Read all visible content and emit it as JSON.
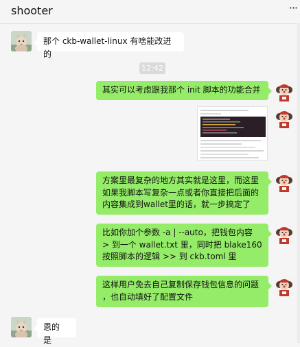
{
  "header": {
    "title": "shooter",
    "menu_icon": "more-dots-icon",
    "menu_label": "···"
  },
  "colors": {
    "outgoing_bubble": "#95ec69",
    "incoming_bubble": "#ffffff",
    "background": "#f5f5f5"
  },
  "messages": [
    {
      "sender": "contact",
      "text": "那个 ckb-wallet-linux 有啥能改进的"
    },
    {
      "sender": "system",
      "text": "12:42"
    },
    {
      "sender": "me",
      "text": "其实可以考虑跟我那个 init 脚本的功能合并"
    },
    {
      "sender": "me",
      "type": "image",
      "text": ""
    },
    {
      "sender": "me",
      "text": "方案里最复杂的地方其实就是这里，而这里\n如果我脚本写复杂一点或者你直接把后面的\n内容集成到wallet里的话，就一步搞定了"
    },
    {
      "sender": "me",
      "text": "比如你加个参数 -a | --auto，把钱包内容\n> 到一个 wallet.txt 里，同时把 blake160\n按照脚本的逻辑 >> 到 ckb.toml 里"
    },
    {
      "sender": "me",
      "text": "这样用户免去自己复制保存钱包信息的问题\n，也自动填好了配置文件"
    },
    {
      "sender": "contact",
      "text": "恩的 是"
    }
  ]
}
